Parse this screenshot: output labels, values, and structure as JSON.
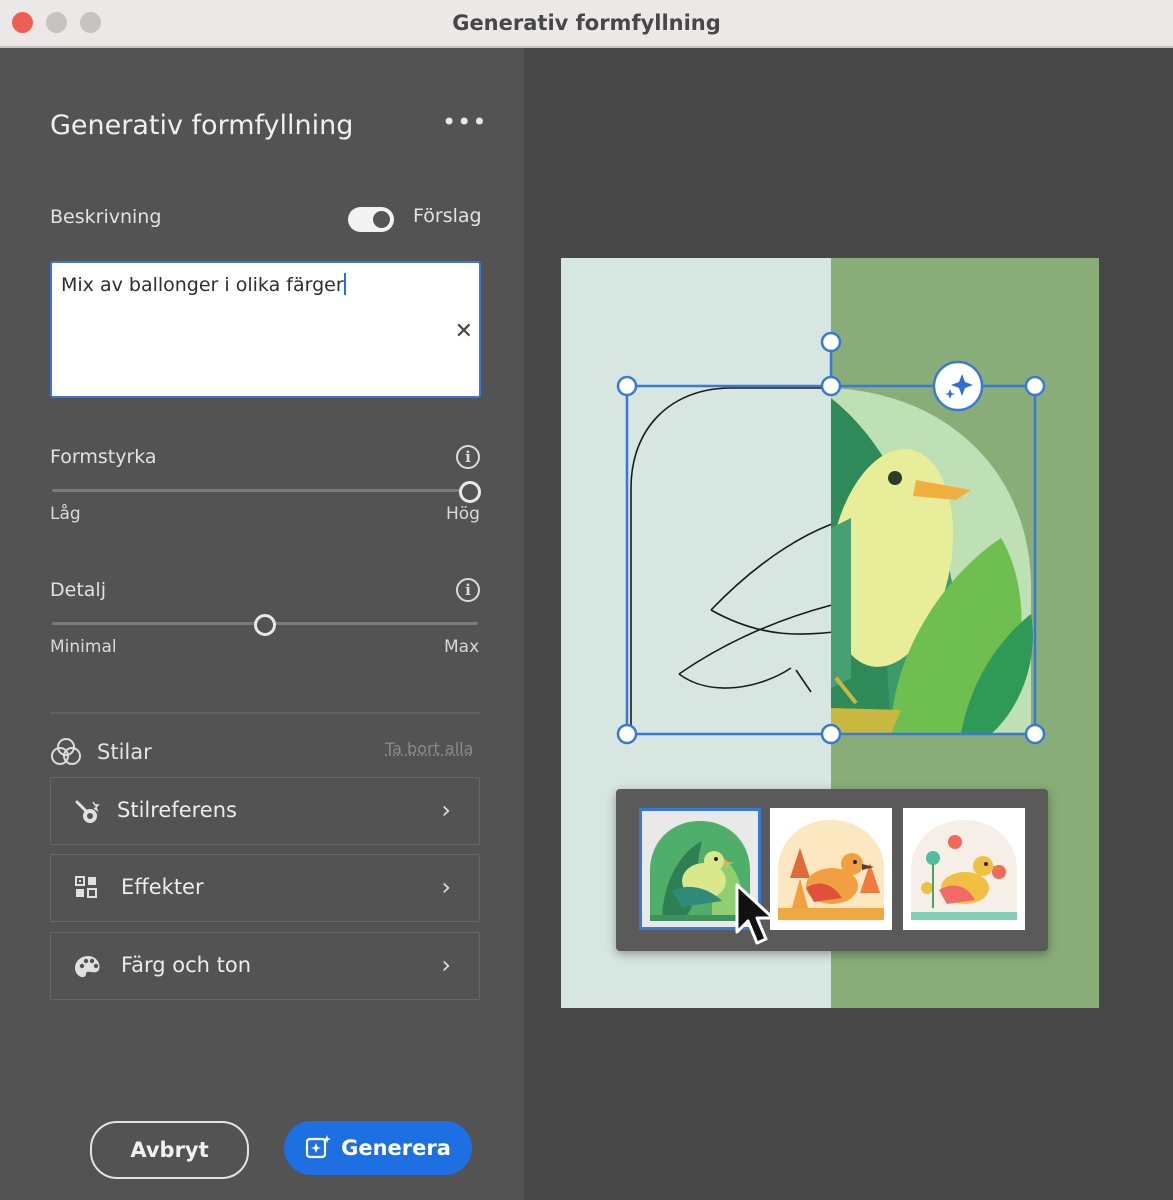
{
  "window": {
    "title": "Generativ formfyllning"
  },
  "panel": {
    "title": "Generativ formfyllning",
    "more_label": "•••",
    "description": {
      "label": "Beskrivning",
      "suggestions_label": "Förslag",
      "suggestions_on": true,
      "value": "Mix av ballonger i olika färger",
      "clear_label": "✕"
    },
    "shape_strength": {
      "label": "Formstyrka",
      "min_label": "Låg",
      "max_label": "Hög",
      "value": 1.0
    },
    "detail": {
      "label": "Detalj",
      "min_label": "Minimal",
      "max_label": "Max",
      "value": 0.5
    },
    "styles": {
      "label": "Stilar",
      "remove_all": "Ta bort alla",
      "items": [
        {
          "label": "Stilreferens",
          "icon": "style-reference-icon"
        },
        {
          "label": "Effekter",
          "icon": "effects-icon"
        },
        {
          "label": "Färg och ton",
          "icon": "palette-icon"
        }
      ]
    },
    "buttons": {
      "cancel": "Avbryt",
      "generate": "Generera"
    }
  },
  "colors": {
    "accent": "#1e6fe2",
    "panel_bg": "#535353",
    "preview_bg": "#474747",
    "selection": "#3b78d6"
  },
  "variations": {
    "count": 3,
    "selected_index": 0
  }
}
